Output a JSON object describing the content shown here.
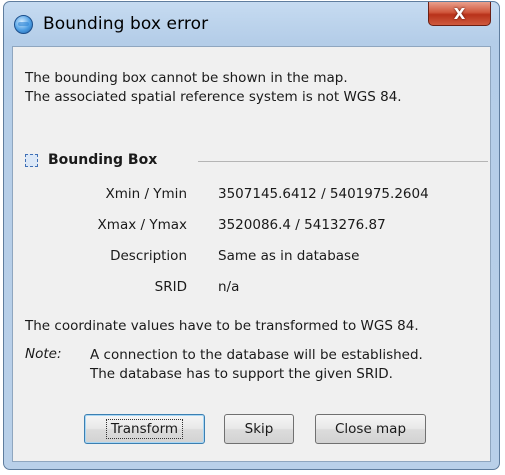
{
  "window": {
    "title": "Bounding box error",
    "close_glyph": "X",
    "icon": "globe-icon"
  },
  "message": {
    "line1": "The bounding box cannot be shown in the map.",
    "line2": "The associated spatial reference system is not WGS 84."
  },
  "group": {
    "title": "Bounding Box",
    "icon": "bounding-box-icon"
  },
  "fields": [
    {
      "label": "Xmin / Ymin",
      "value": "3507145.6412 / 5401975.2604"
    },
    {
      "label": "Xmax / Ymax",
      "value": "3520086.4 / 5413276.87"
    },
    {
      "label": "Description",
      "value": "Same as in database"
    },
    {
      "label": "SRID",
      "value": "n/a"
    }
  ],
  "info": "The coordinate values have to be transformed to WGS 84.",
  "note": {
    "label": "Note:",
    "line1": "A connection to the database will be established.",
    "line2": "The database has to support the given SRID."
  },
  "buttons": {
    "transform": "Transform",
    "skip": "Skip",
    "close_map": "Close map"
  },
  "colors": {
    "title_bar": "#b9d0e9",
    "close_button": "#c8452a",
    "client_bg": "#f0f0f0"
  }
}
